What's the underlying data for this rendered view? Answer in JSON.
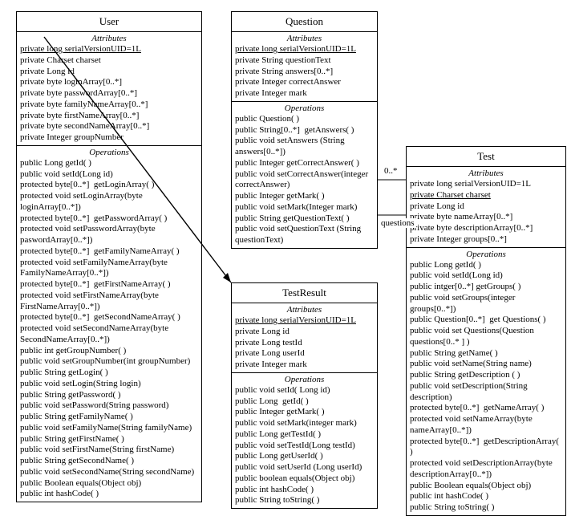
{
  "user": {
    "title": "User",
    "attr_label": "Attributes",
    "attrs": [
      {
        "t": "private long serialVersionUID=1L",
        "u": true
      },
      {
        "t": "private Charset charset"
      },
      {
        "t": "private Long id"
      },
      {
        "t": "private byte loginArray[0..*]"
      },
      {
        "t": "private byte passwordArray[0..*]"
      },
      {
        "t": "private byte familyNameArray[0..*]"
      },
      {
        "t": "private byte firstNameArray[0..*]"
      },
      {
        "t": "private byte secondNameArray[0..*]"
      },
      {
        "t": "private Integer groupNumber"
      }
    ],
    "ops_label": "Operations",
    "ops": [
      {
        "t": "public Long getId( )"
      },
      {
        "t": "public void setId(Long id)"
      },
      {
        "t": "protected byte[0..*]  getLoginArray( )"
      },
      {
        "t": "protected void setLoginArray(byte loginArray[0..*])"
      },
      {
        "t": "protected byte[0..*]  getPasswordArray( )"
      },
      {
        "t": "protected void setPasswordArray(byte paswordArray[0..*])"
      },
      {
        "t": "protected byte[0..*]  getFamilyNameArray( )"
      },
      {
        "t": "protected void setFamilyNameArray(byte FamilyNameArray[0..*])"
      },
      {
        "t": "protected byte[0..*]  getFirstNameArray( )"
      },
      {
        "t": "protected void setFirstNameArray(byte FirstNameArray[0..*])"
      },
      {
        "t": "protected byte[0..*]  getSecondNameArray( )"
      },
      {
        "t": "protected void setSecondNameArray(byte SecondNameArray[0..*])"
      },
      {
        "t": "public int getGroupNumber( )"
      },
      {
        "t": "public void setGroupNumber(int groupNumber)"
      },
      {
        "t": "public String getLogin( )"
      },
      {
        "t": "public void setLogin(String login)"
      },
      {
        "t": "public String getPassword( )"
      },
      {
        "t": "public void setPassword(String password)"
      },
      {
        "t": "public String getFamilyName( )"
      },
      {
        "t": "public void setFamilyName(String familyName)"
      },
      {
        "t": "public String getFirstName( )"
      },
      {
        "t": "public void setFirstName(String firstName)"
      },
      {
        "t": "public String getSecondName( )"
      },
      {
        "t": "public void setSecondName(String secondName)"
      },
      {
        "t": "public Boolean equals(Object obj)"
      },
      {
        "t": "public int hashCode( )"
      }
    ]
  },
  "question": {
    "title": "Question",
    "attr_label": "Attributes",
    "attrs": [
      {
        "t": "private long serialVersionUID=1L",
        "u": true
      },
      {
        "t": "private String questionText"
      },
      {
        "t": "private String answers[0..*]"
      },
      {
        "t": "private Integer correctAnswer"
      },
      {
        "t": "private Integer mark"
      }
    ],
    "ops_label": "Operations",
    "ops": [
      {
        "t": "public Question( )"
      },
      {
        "t": "public String[0..*]  getAnswers( )"
      },
      {
        "t": "public void setAnswers (String answers[0..*])"
      },
      {
        "t": "public Integer getCorrectAnswer( )"
      },
      {
        "t": "public void setCorrectAnswer(integer correctAnswer)"
      },
      {
        "t": "public Integer getMark( )"
      },
      {
        "t": "public void setMark(Integer mark)"
      },
      {
        "t": "public String getQuestionText( )"
      },
      {
        "t": "public void setQuestionText (String questionText)"
      }
    ]
  },
  "testresult": {
    "title": "TestResult",
    "attr_label": "Attributes",
    "attrs": [
      {
        "t": "private long serialVersionUID=1L",
        "u": true
      },
      {
        "t": "private Long id"
      },
      {
        "t": "private Long testId"
      },
      {
        "t": "private Long userId"
      },
      {
        "t": "private Integer mark"
      }
    ],
    "ops_label": "Operations",
    "ops": [
      {
        "t": "public void setId( Long id)"
      },
      {
        "t": "public Long  getId( )"
      },
      {
        "t": "public Integer getMark( )"
      },
      {
        "t": "public void setMark(integer mark)"
      },
      {
        "t": "public Long getTestId( )"
      },
      {
        "t": "public void setTestId(Long testId)"
      },
      {
        "t": "public Long getUserId( )"
      },
      {
        "t": "public void setUserId (Long userId)"
      },
      {
        "t": "public boolean equals(Object obj)"
      },
      {
        "t": "public int hashCode( )"
      },
      {
        "t": "public String toString( )"
      }
    ]
  },
  "test": {
    "title": "Test",
    "attr_label": "Attributes",
    "attrs": [
      {
        "t": "private long serialVersionUID=1L"
      },
      {
        "t": "private Charset charset",
        "u": true
      },
      {
        "t": "private Long id"
      },
      {
        "t": "private byte nameArray[0..*]"
      },
      {
        "t": "private byte descriptionArray[0..*]"
      },
      {
        "t": "private Integer groups[0..*]"
      }
    ],
    "ops_label": "Operations",
    "ops": [
      {
        "t": "public Long getId( )"
      },
      {
        "t": "public void setId(Long id)"
      },
      {
        "t": "public intger[0..*] getGroups( )"
      },
      {
        "t": "public void setGroups(integer groups[0..*])"
      },
      {
        "t": "public Question[0..*]  get Questions( )"
      },
      {
        "t": "public void set Questions(Question questions[0..* ] )"
      },
      {
        "t": "public String getName( )"
      },
      {
        "t": "public void setName(String name)"
      },
      {
        "t": "public String getDescription ( )"
      },
      {
        "t": "public void setDescription(String description)"
      },
      {
        "t": "protected byte[0..*]  getNameArray( )"
      },
      {
        "t": "protected void setNameArray(byte nameArray[0..*])"
      },
      {
        "t": "protected byte[0..*]  getDescriptionArray( )"
      },
      {
        "t": "protected void setDescriptionArray(byte descriptionArray[0..*])"
      },
      {
        "t": "public Boolean equals(Object obj)"
      },
      {
        "t": "public int hashCode( )"
      },
      {
        "t": "public String toString( )"
      }
    ]
  },
  "assoc": {
    "mult": "0..*",
    "role": "questions"
  }
}
